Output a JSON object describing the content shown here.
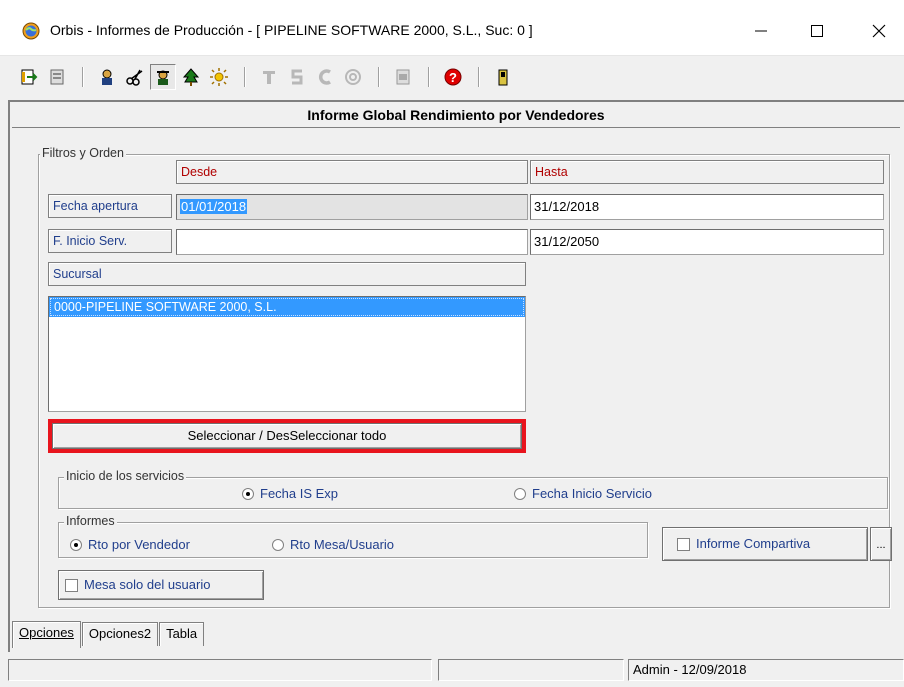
{
  "window": {
    "title": "Orbis - Informes de Producción - [ PIPELINE SOFTWARE 2000, S.L.,  Suc: 0 ]",
    "minimize_icon": "minimize-icon",
    "maximize_icon": "maximize-icon",
    "close_icon": "close-icon"
  },
  "toolbar": {
    "icons": [
      "exit-icon",
      "document-icon",
      "person-icon",
      "scissors-icon",
      "agent-icon",
      "tree-icon",
      "sun-icon",
      "letter-t-icon",
      "letter-s-icon",
      "letter-c-icon",
      "at-sign-icon",
      "print-preview-icon",
      "help-icon",
      "door-icon"
    ]
  },
  "form": {
    "header": "Informe Global Rendimiento por Vendedores",
    "filters": {
      "legend": "Filtros y Orden",
      "desde_label": "Desde",
      "hasta_label": "Hasta",
      "fecha_apertura_label": "Fecha apertura",
      "fecha_apertura_desde": "01/01/2018",
      "fecha_apertura_hasta": "31/12/2018",
      "inicio_serv_label": "F. Inicio Serv.",
      "inicio_serv_desde": "",
      "inicio_serv_hasta": "31/12/2050",
      "sucursal_label": "Sucursal",
      "sucursal_items": [
        "0000-PIPELINE SOFTWARE 2000, S.L."
      ],
      "select_all_button": "Seleccionar / DesSeleccionar todo"
    },
    "inicio_servicios": {
      "legend": "Inicio de los servicios",
      "option1": "Fecha IS Exp",
      "option2": "Fecha Inicio Servicio",
      "selected": "Fecha IS Exp"
    },
    "informes": {
      "legend": "Informes",
      "option1": "Rto por Vendedor",
      "option2": "Rto Mesa/Usuario",
      "selected": "Rto por Vendedor",
      "compartiva_label": "Informe Compartiva",
      "more_button": "..."
    },
    "mesa_solo_usuario": "Mesa solo del usuario"
  },
  "tabs": [
    "Opciones",
    "Opciones2",
    "Tabla"
  ],
  "status": {
    "right": "Admin - 12/09/2018"
  },
  "colors": {
    "highlight": "#e8141d",
    "selection": "#3399ff",
    "label_red": "#b00000",
    "label_blue": "#203e8c"
  }
}
